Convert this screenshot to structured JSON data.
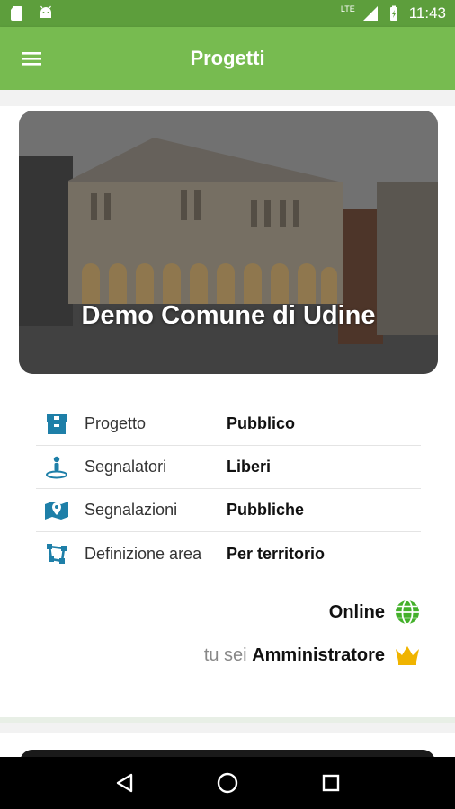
{
  "status_bar": {
    "time": "11:43",
    "network": "LTE",
    "icons": [
      "sd-card-icon",
      "android-icon",
      "lte-signal-icon",
      "battery-charging-icon"
    ]
  },
  "app_bar": {
    "title": "Progetti",
    "menu_icon": "hamburger-menu-icon"
  },
  "project": {
    "name": "Demo Comune di Udine",
    "image": "udine-loggia-photo"
  },
  "info": [
    {
      "icon": "box-icon",
      "label": "Progetto",
      "value": "Pubblico"
    },
    {
      "icon": "person-pin-icon",
      "label": "Segnalatori",
      "value": "Liberi"
    },
    {
      "icon": "map-pin-icon",
      "label": "Segnalazioni",
      "value": "Pubbliche"
    },
    {
      "icon": "area-icon",
      "label": "Definizione area",
      "value": "Per territorio"
    }
  ],
  "connection": {
    "status": "Online",
    "icon": "globe-icon",
    "color": "#43b02a"
  },
  "role": {
    "prefix": "tu sei",
    "name": "Amministratore",
    "icon": "crown-icon",
    "color": "#f0b400"
  },
  "colors": {
    "status_bar": "#5d9e3c",
    "app_bar": "#77bb50",
    "info_icon": "#1e7fa8"
  },
  "nav_bar": {
    "icons": [
      "back-icon",
      "home-icon",
      "recents-icon"
    ]
  }
}
